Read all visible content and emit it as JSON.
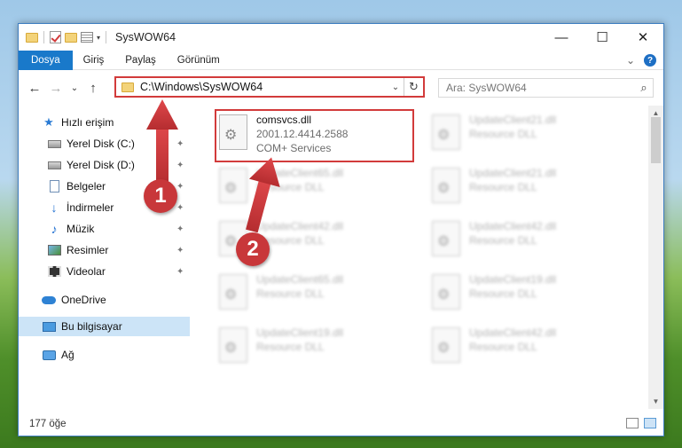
{
  "window": {
    "title": "SysWOW64"
  },
  "window_controls": {
    "minimize": "—",
    "maximize": "☐",
    "close": "✕"
  },
  "ribbon": {
    "tabs": [
      "Dosya",
      "Giriş",
      "Paylaş",
      "Görünüm"
    ],
    "collapse_glyph": "⌄",
    "help_glyph": "?"
  },
  "navigation": {
    "back": "←",
    "forward": "→",
    "recent": "⌄",
    "up": "↑",
    "address": "C:\\Windows\\SysWOW64",
    "address_dropdown": "⌄",
    "refresh": "↻",
    "search_placeholder": "Ara: SysWOW64",
    "search_icon": "⌕"
  },
  "sidebar": {
    "items": [
      {
        "label": "Hızlı erişim",
        "icon": "star-icon",
        "pinned": false
      },
      {
        "label": "Yerel Disk (C:)",
        "icon": "drive-icon",
        "pinned": true
      },
      {
        "label": "Yerel Disk (D:)",
        "icon": "drive-icon",
        "pinned": true
      },
      {
        "label": "Belgeler",
        "icon": "document-icon",
        "pinned": true
      },
      {
        "label": "İndirmeler",
        "icon": "download-icon",
        "pinned": true
      },
      {
        "label": "Müzik",
        "icon": "music-icon",
        "pinned": true
      },
      {
        "label": "Resimler",
        "icon": "pictures-icon",
        "pinned": true
      },
      {
        "label": "Videolar",
        "icon": "video-icon",
        "pinned": true
      },
      {
        "label": "OneDrive",
        "icon": "cloud-icon",
        "pinned": false
      },
      {
        "label": "Bu bilgisayar",
        "icon": "computer-icon",
        "pinned": false,
        "selected": true
      },
      {
        "label": "Ağ",
        "icon": "network-icon",
        "pinned": false
      }
    ],
    "pin_glyph": "📌"
  },
  "files": {
    "highlighted": {
      "name": "comsvcs.dll",
      "line2": "2001.12.4414.2588",
      "line3": "COM+ Services"
    },
    "blurred": [
      {
        "name": "UpdateClient21.dll",
        "desc": "Resource DLL"
      },
      {
        "name": "UpdateClient65.dll",
        "desc": "Resource DLL"
      },
      {
        "name": "UpdateClient21.dll",
        "desc": "Resource DLL"
      },
      {
        "name": "UpdateClient42.dll",
        "desc": "Resource DLL"
      },
      {
        "name": "UpdateClient42.dll",
        "desc": "Resource DLL"
      },
      {
        "name": "UpdateClient65.dll",
        "desc": "Resource DLL"
      },
      {
        "name": "UpdateClient19.dll",
        "desc": "Resource DLL"
      },
      {
        "name": "UpdateClient19.dll",
        "desc": "Resource DLL"
      },
      {
        "name": "UpdateClient42.dll",
        "desc": "Resource DLL"
      }
    ]
  },
  "status": {
    "count": "177 öğe"
  },
  "annotations": {
    "step1": "1",
    "step2": "2"
  },
  "colors": {
    "accent": "#1979ca",
    "highlight": "#d23b3b",
    "selection": "#cce4f7"
  }
}
